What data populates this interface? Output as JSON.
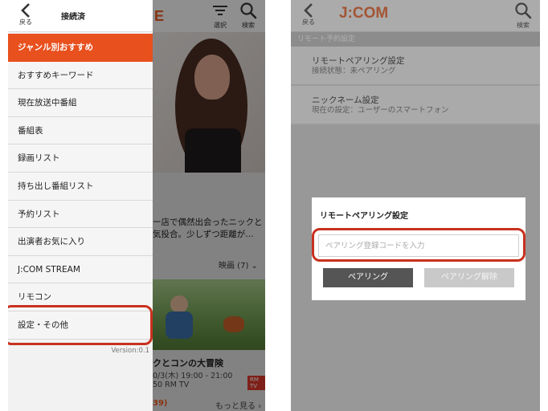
{
  "left_phone": {
    "drawer": {
      "back_label": "戻る",
      "title": "接続済",
      "menu": [
        {
          "label": "ジャンル別おすすめ"
        },
        {
          "label": "おすすめキーワード"
        },
        {
          "label": "現在放送中番組"
        },
        {
          "label": "番組表"
        },
        {
          "label": "録画リスト"
        },
        {
          "label": "持ち出し番組リスト"
        },
        {
          "label": "予約リスト"
        },
        {
          "label": "出演者お気に入り"
        },
        {
          "label": "J:COM STREAM"
        },
        {
          "label": "リモコン"
        },
        {
          "label": "設定・その他"
        }
      ],
      "version": "Version:0.1"
    },
    "background": {
      "logo_fragment": "E",
      "filter_label": "選択",
      "search_label": "検索",
      "description": "ー店で偶然出会ったニックと気投合。少しずつ距離が…",
      "genre": "映画 (7)",
      "title2": "クとコンの大冒険",
      "time": "0/3(木) 19:00 - 21:00",
      "channel": "50 RM TV",
      "badge": "RM TV",
      "count": "39)",
      "more": "もっと見る"
    }
  },
  "right_phone": {
    "back_label": "戻る",
    "logo": "J:COM",
    "search_label": "検索",
    "section_title": "リモート予約設定",
    "settings": [
      {
        "title": "リモートペアリング設定",
        "sub": "接続状態：未ペアリング"
      },
      {
        "title": "ニックネーム設定",
        "sub": "現在の設定：ユーザーのスマートフォン"
      }
    ],
    "dialog": {
      "title": "リモートペアリング設定",
      "input_placeholder": "ペアリング登録コードを入力",
      "pair_button": "ペアリング",
      "unpair_button": "ペアリング解除"
    }
  },
  "colors": {
    "accent": "#e8501e",
    "highlight": "#c8311e",
    "dark_button": "#555555",
    "disabled_button": "#c9c9c9"
  }
}
